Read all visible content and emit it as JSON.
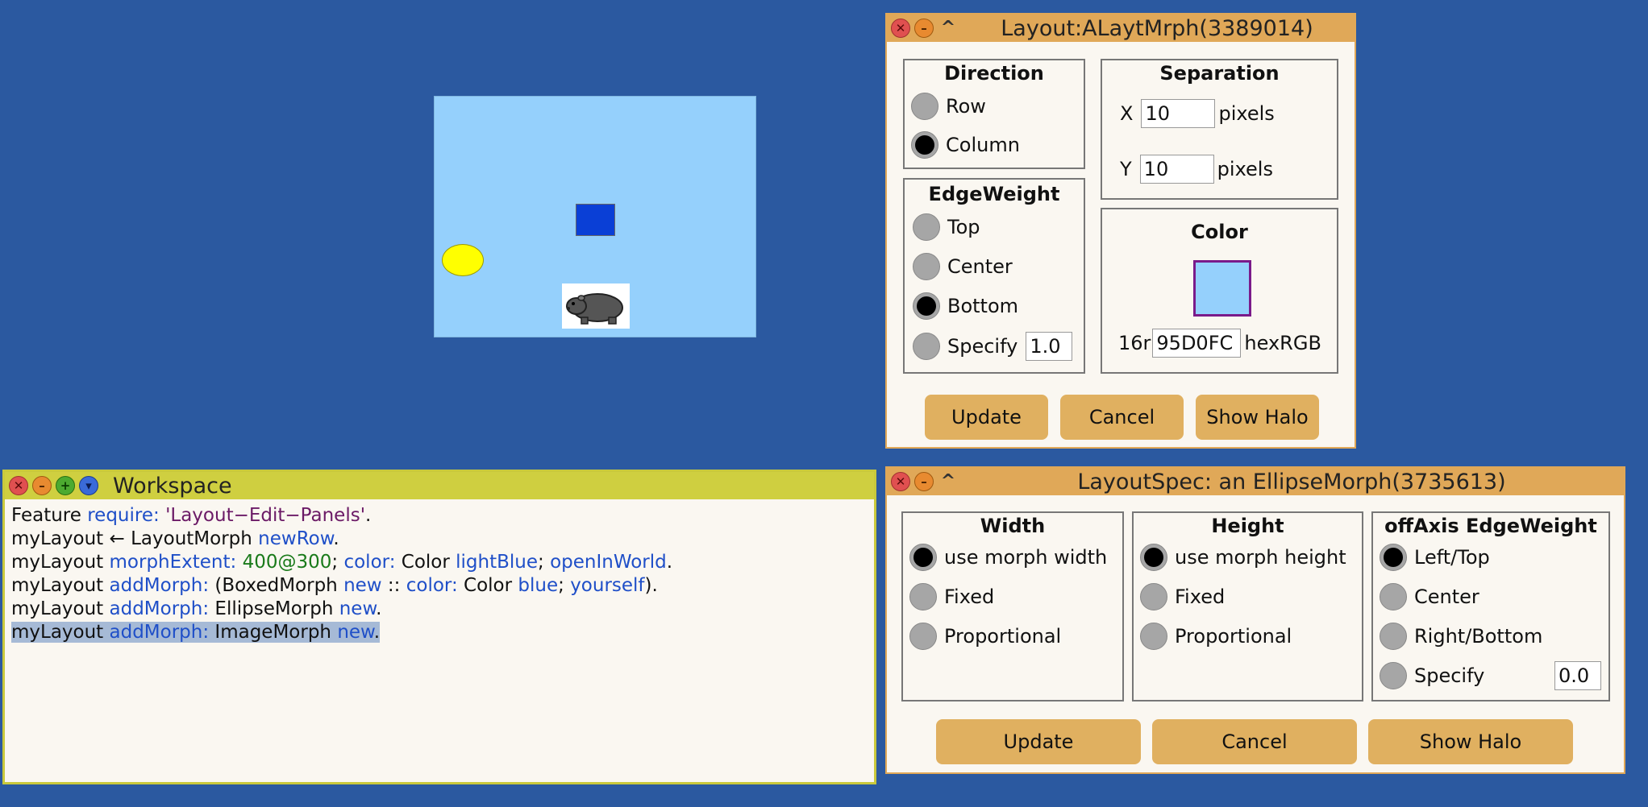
{
  "colors": {
    "desktop": "#2b59a0",
    "layout_color": "#95d0fc",
    "panel_title": "#e0a858",
    "workspace_title": "#cfcf40",
    "button": "#e0b060"
  },
  "layout_panel": {
    "title": "Layout:ALaytMrph(3389014)",
    "direction": {
      "title": "Direction",
      "options": [
        "Row",
        "Column"
      ],
      "selected": "Column"
    },
    "separation": {
      "title": "Separation",
      "x_label": "X",
      "x_value": "10",
      "y_label": "Y",
      "y_value": "10",
      "unit": "pixels"
    },
    "edge_weight": {
      "title": "EdgeWeight",
      "options": [
        "Top",
        "Center",
        "Bottom",
        "Specify"
      ],
      "selected": "Bottom",
      "specify_value": "1.0"
    },
    "color": {
      "title": "Color",
      "prefix": "16r",
      "hex": "95D0FC",
      "suffix": "hexRGB",
      "swatch": "#95d0fc"
    },
    "buttons": {
      "update": "Update",
      "cancel": "Cancel",
      "show_halo": "Show Halo"
    }
  },
  "workspace": {
    "title": "Workspace",
    "lines": [
      [
        {
          "t": "Feature "
        },
        {
          "t": "require: ",
          "c": "kw"
        },
        {
          "t": "'Layout−Edit−Panels'",
          "c": "str"
        },
        {
          "t": "."
        }
      ],
      [
        {
          "t": "myLayout ← LayoutMorph "
        },
        {
          "t": "newRow",
          "c": "kw"
        },
        {
          "t": "."
        }
      ],
      [
        {
          "t": "myLayout "
        },
        {
          "t": "morphExtent: ",
          "c": "kw"
        },
        {
          "t": "400@300",
          "c": "num"
        },
        {
          "t": "; "
        },
        {
          "t": "color: ",
          "c": "kw"
        },
        {
          "t": "Color "
        },
        {
          "t": "lightBlue",
          "c": "kw"
        },
        {
          "t": "; "
        },
        {
          "t": "openInWorld",
          "c": "kw"
        },
        {
          "t": "."
        }
      ],
      [
        {
          "t": "myLayout "
        },
        {
          "t": "addMorph: ",
          "c": "kw"
        },
        {
          "t": "(BoxedMorph "
        },
        {
          "t": "new",
          "c": "kw"
        },
        {
          "t": " :: "
        },
        {
          "t": "color: ",
          "c": "kw"
        },
        {
          "t": "Color "
        },
        {
          "t": "blue",
          "c": "kw"
        },
        {
          "t": "; "
        },
        {
          "t": "yourself",
          "c": "kw"
        },
        {
          "t": ")."
        }
      ],
      [
        {
          "t": "myLayout "
        },
        {
          "t": "addMorph: ",
          "c": "kw"
        },
        {
          "t": "EllipseMorph "
        },
        {
          "t": "new",
          "c": "kw"
        },
        {
          "t": "."
        }
      ],
      [
        {
          "t": "myLayout "
        },
        {
          "t": "addMorph: ",
          "c": "kw"
        },
        {
          "t": "ImageMorph "
        },
        {
          "t": "new",
          "c": "kw"
        },
        {
          "t": "."
        }
      ]
    ],
    "selected_line": 5
  },
  "spec_panel": {
    "title": "LayoutSpec: an EllipseMorph(3735613)",
    "width": {
      "title": "Width",
      "options": [
        "use morph width",
        "Fixed",
        "Proportional"
      ],
      "selected": "use morph width"
    },
    "height": {
      "title": "Height",
      "options": [
        "use morph height",
        "Fixed",
        "Proportional"
      ],
      "selected": "use morph height"
    },
    "off_axis": {
      "title": "offAxis EdgeWeight",
      "options": [
        "Left/Top",
        "Center",
        "Right/Bottom",
        "Specify"
      ],
      "selected": "Left/Top",
      "specify_value": "0.0"
    },
    "buttons": {
      "update": "Update",
      "cancel": "Cancel",
      "show_halo": "Show Halo"
    }
  }
}
